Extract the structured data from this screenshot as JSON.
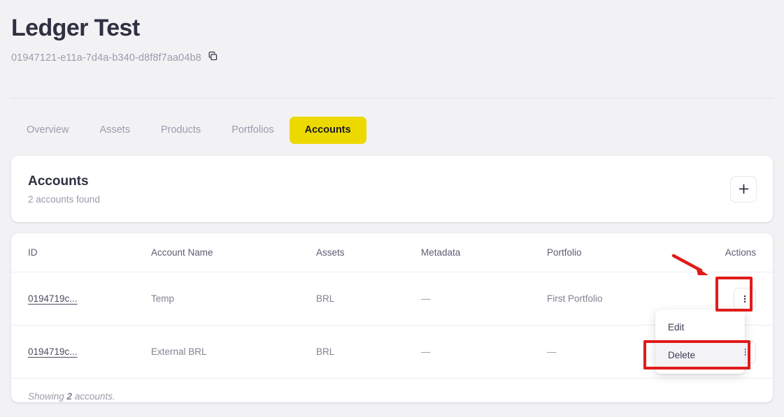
{
  "header": {
    "title": "Ledger Test",
    "uuid": "01947121-e11a-7d4a-b340-d8f8f7aa04b8",
    "copy_icon": "copy-icon"
  },
  "tabs": [
    {
      "label": "Overview",
      "active": false
    },
    {
      "label": "Assets",
      "active": false
    },
    {
      "label": "Products",
      "active": false
    },
    {
      "label": "Portfolios",
      "active": false
    },
    {
      "label": "Accounts",
      "active": true
    }
  ],
  "summary": {
    "title": "Accounts",
    "subtitle": "2 accounts found",
    "add_button_icon": "plus-icon"
  },
  "table": {
    "columns": [
      "ID",
      "Account Name",
      "Assets",
      "Metadata",
      "Portfolio",
      "Actions"
    ],
    "rows": [
      {
        "id": "0194719c...",
        "name": "Temp",
        "assets": "BRL",
        "metadata": "—",
        "portfolio": "First Portfolio",
        "actions_icon": "kebab-menu-icon"
      },
      {
        "id": "0194719c...",
        "name": "External BRL",
        "assets": "BRL",
        "metadata": "—",
        "portfolio": "—",
        "actions_icon": "kebab-menu-icon"
      }
    ],
    "footer_prefix": "Showing ",
    "footer_count": "2",
    "footer_suffix": " accounts."
  },
  "dropdown": {
    "items": [
      {
        "label": "Edit",
        "hovered": false
      },
      {
        "label": "Delete",
        "hovered": true
      }
    ]
  },
  "colors": {
    "page_background": "#f2f2f5",
    "accent_yellow": "#ecd900",
    "text_dark": "#2f3142",
    "text_muted": "#9b9cab",
    "annotation_red": "#e01b1b",
    "card_white": "#ffffff"
  }
}
